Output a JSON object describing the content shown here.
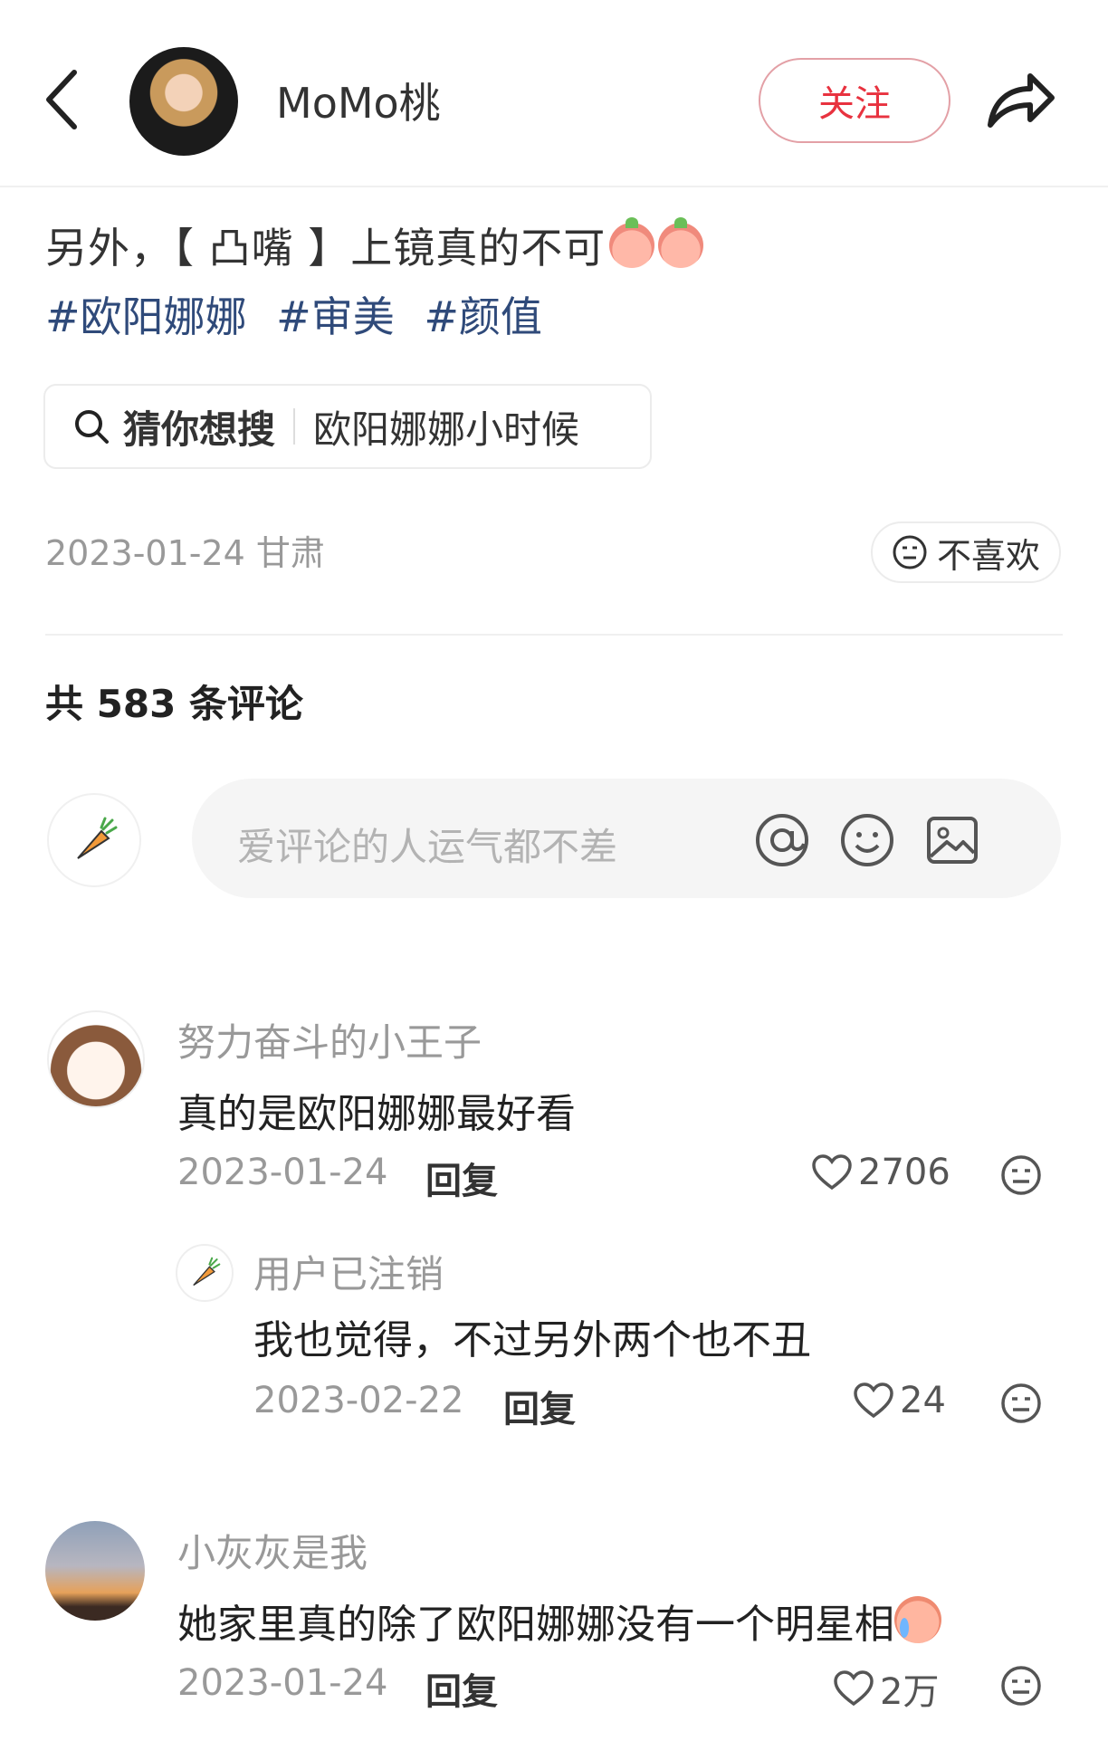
{
  "header": {
    "author": "MoMo桃",
    "follow_label": "关注"
  },
  "post": {
    "text": "另外，【 凸嘴 】上镜真的不可",
    "tags": [
      "#欧阳娜娜",
      "#审美",
      "#颜值"
    ],
    "guess_title": "猜你想搜",
    "guess_query": "欧阳娜娜小时候",
    "date_location": "2023-01-24 甘肃",
    "dislike_label": "不喜欢"
  },
  "comments_header": {
    "count_text": "共 583 条评论",
    "input_placeholder": "爱评论的人运气都不差"
  },
  "comments": [
    {
      "name": "努力奋斗的小王子",
      "text": "真的是欧阳娜娜最好看",
      "date": "2023-01-24",
      "reply": "回复",
      "likes": "2706"
    },
    {
      "name": "用户已注销",
      "text": "我也觉得，不过另外两个也不丑",
      "date": "2023-02-22",
      "reply": "回复",
      "likes": "24"
    },
    {
      "name": "小灰灰是我",
      "text": "她家里真的除了欧阳娜娜没有一个明星相",
      "date": "2023-01-24",
      "reply": "回复",
      "likes": "2万"
    }
  ],
  "colors": {
    "accent": "#e8323f",
    "tag": "#2f4a7a",
    "muted": "#999999"
  }
}
